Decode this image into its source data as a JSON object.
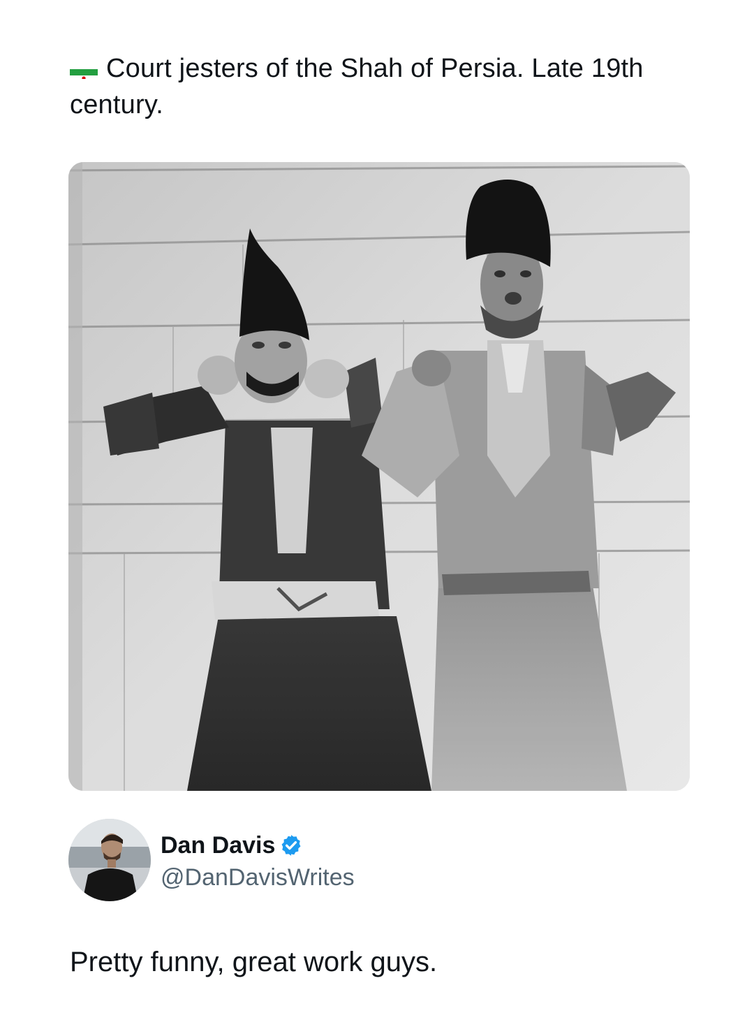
{
  "quoted_post": {
    "flag_icon": "iran-flag-icon",
    "caption": "Court jesters of the Shah of Persia. Late 19th century."
  },
  "photo": {
    "description_icon": "black-and-white-photo-two-jesters"
  },
  "author": {
    "name": "Dan Davis",
    "handle": "@DanDavisWrites",
    "verified_icon": "verified-badge-icon",
    "verified_color": "#1d9bf0"
  },
  "reply": {
    "text": "Pretty funny, great work guys."
  },
  "colors": {
    "text": "#0f1419",
    "secondary_text": "#536471",
    "background": "#ffffff"
  }
}
